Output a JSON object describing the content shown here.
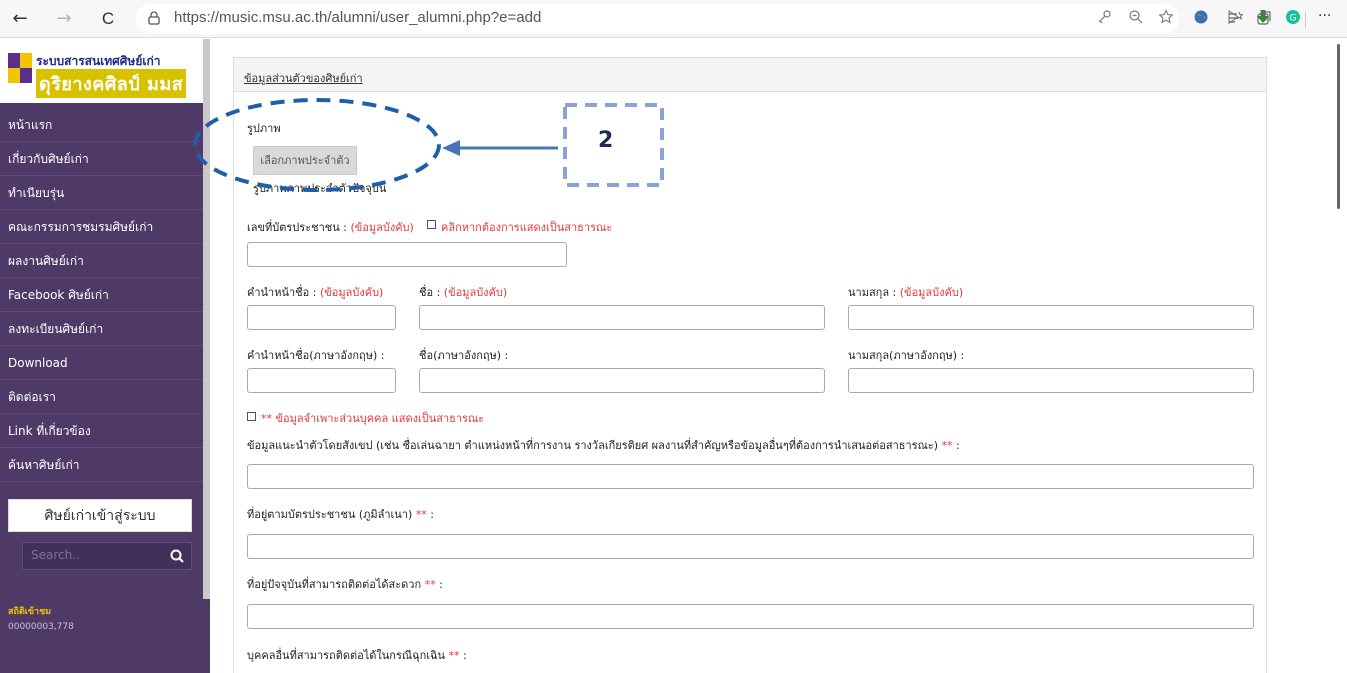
{
  "browser": {
    "url": "https://music.msu.ac.th/alumni/user_alumni.php?e=add",
    "back_glyph": "←",
    "forward_glyph": "→",
    "reload_glyph": "C",
    "lock_glyph": "🔒",
    "more_glyph": "···"
  },
  "brand": {
    "line1": "ระบบสารสนเทศศิษย์เก่า",
    "line2": "ดุริยางคศิลป์ มมส"
  },
  "sidebar": {
    "items": [
      {
        "label": "หน้าแรก"
      },
      {
        "label": "เกี่ยวกับศิษย์เก่า"
      },
      {
        "label": "ทำเนียบรุ่น"
      },
      {
        "label": "คณะกรรมการชมรมศิษย์เก่า"
      },
      {
        "label": "ผลงานศิษย์เก่า"
      },
      {
        "label": "Facebook ศิษย์เก่า"
      },
      {
        "label": "ลงทะเบียนศิษย์เก่า"
      },
      {
        "label": "Download"
      },
      {
        "label": "ติดต่อเรา"
      },
      {
        "label": "Link ที่เกี่ยวข้อง"
      },
      {
        "label": "ค้นหาศิษย์เก่า"
      }
    ],
    "login_label": "ศิษย์เก่าเข้าสู่ระบบ",
    "search_placeholder": "Search..",
    "stat_label": "สถิติเข้าชม",
    "stat_value": "00000003,778"
  },
  "form": {
    "panel_title": "ข้อมูลส่วนตัวของศิษย์เก่า",
    "photo_label": "รูปภาพ",
    "photo_button": "เลือกภาพประจำตัว",
    "photo_current": "รูปภาพภาพประจำตัวปัจจุบัน",
    "id_label": "เลขที่บัตรประชาชน : ",
    "required_tag": "(ข้อมูลบังคับ)",
    "public_check_label": "คลิกหากต้องการแสดงเป็นสาธารณะ",
    "prefix_label": "คำนำหน้าชื่อ : ",
    "firstname_label": "ชื่อ : ",
    "lastname_label": "นามสกุล : ",
    "prefix_en_label": "คำนำหน้าชื่อ(ภาษาอังกฤษ) :",
    "firstname_en_label": "ชื่อ(ภาษาอังกฤษ) :",
    "lastname_en_label": "นามสกุล(ภาษาอังกฤษ) :",
    "private_check_label": "** ข้อมูลจำเพาะส่วนบุคคล แสดงเป็นสาธารณะ",
    "intro_label": "ข้อมูลแนะนำตัวโดยสังเขป (เช่น ชื่อเล่นฉายา ตำแหน่งหน้าที่การงาน รางวัลเกียรติยศ ผลงานที่สำคัญหรือข้อมูลอื่นๆที่ต้องการนำเสนอต่อสาธารณะ)",
    "address_id_label": "ที่อยู่ตามบัตรประชาชน (ภูมิลำเนา)",
    "address_current_label": "ที่อยู่ปัจจุบันที่สามารถติดต่อได้สะดวก",
    "emergency_label": "บุคคลอื่นที่สามารถติดต่อได้ในกรณีฉุกเฉิน",
    "star_mark": "**",
    "colon": " :"
  },
  "annotation": {
    "number": "2",
    "color": "#1f5fa8"
  }
}
